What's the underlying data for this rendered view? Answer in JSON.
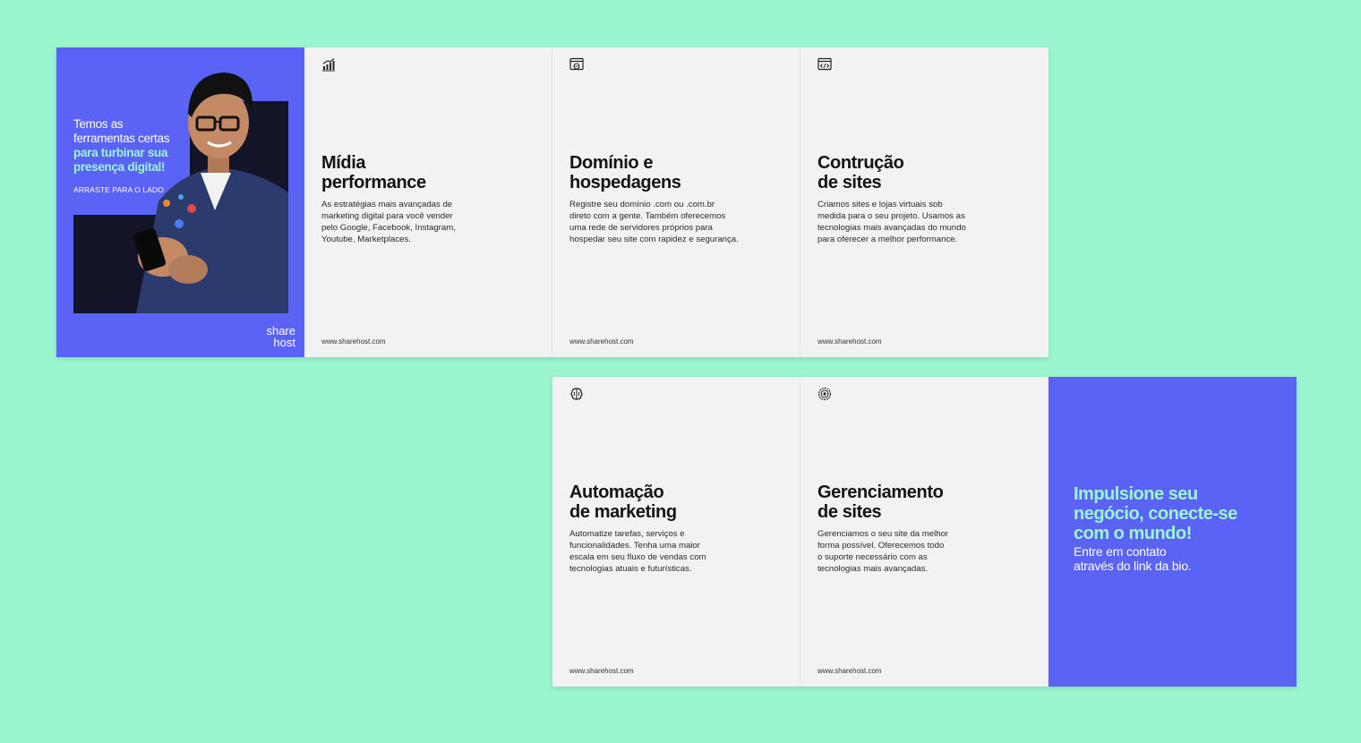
{
  "colors": {
    "background": "#9bf6cf",
    "brand_blue": "#5b63f7",
    "panel": "#f2f2f2",
    "accent_mint": "#9bf6cf"
  },
  "cover": {
    "line_white": "Temos as\nferramentas certas",
    "line_mint": "para turbinar sua\npresença digital!",
    "swipe": "ARRASTE PARA O LADO",
    "logo_top": "share",
    "logo_bottom": "host"
  },
  "panels": [
    {
      "icon": "chart-growth-icon",
      "title": "Mídia\nperformance",
      "desc": "As estratégias mais avançadas de\nmarketing digital para você vender\npelo Google, Facebook, Instagram,\nYoutube, Marketplaces.",
      "url": "www.sharehost.com"
    },
    {
      "icon": "browser-globe-icon",
      "title": "Domínio e\nhospedagens",
      "desc": "Registre seu domínio .com ou .com.br\ndireto com a gente. Também oferecemos\numa rede de servidores próprios para\nhospedar seu site com rapidez e segurança.",
      "url": "www.sharehost.com"
    },
    {
      "icon": "browser-code-icon",
      "title": "Contrução\nde sites",
      "desc": "Criamos sites e lojas virtuais sob\nmedida para o seu projeto. Usamos as\ntecnologias mais avançadas do mundo\npara oferecer a melhor performance.",
      "url": "www.sharehost.com"
    },
    {
      "icon": "brain-icon",
      "title": "Automação\nde marketing",
      "desc": "Automatize tarefas, serviços e\nfuncionalidades. Tenha uma maior\nescala em seu fluxo de vendas com\ntecnologias atuais e futurísticas.",
      "url": "www.sharehost.com"
    },
    {
      "icon": "target-gear-icon",
      "title": "Gerenciamento\nde sites",
      "desc": "Gerenciamos o seu site da melhor\nforma possível. Oferecemos todo\no suporte necessário com as\ntecnologias mais avançadas.",
      "url": "www.sharehost.com"
    }
  ],
  "final": {
    "headline": "Impulsione seu\nnegócio, conecte-se\ncom o mundo!",
    "sub": "Entre em contato\natravés do link da bio."
  }
}
